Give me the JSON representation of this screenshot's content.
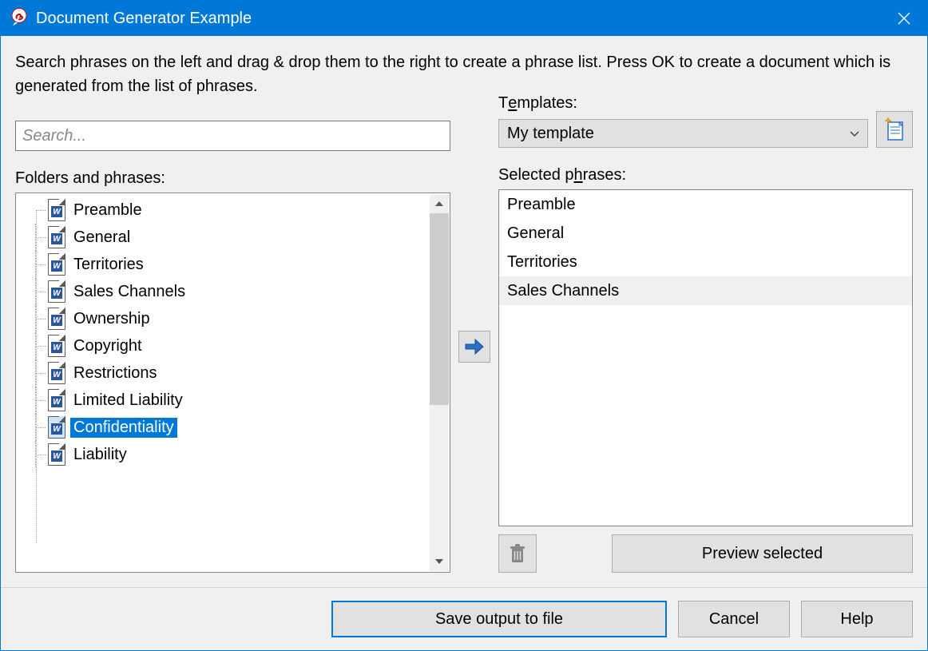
{
  "title": "Document Generator Example",
  "instructions": "Search phrases on the left and drag & drop them to the right to create a phrase list. Press OK to create a document which is generated from the list of phrases.",
  "search": {
    "placeholder": "Search..."
  },
  "labels": {
    "folders_and_phrases": "Folders and phrases:",
    "templates_prefix": "T",
    "templates_ul": "e",
    "templates_suffix": "mplates:",
    "selected_prefix": "Selected p",
    "selected_ul": "h",
    "selected_suffix": "rases:"
  },
  "templates": {
    "selected": "My template"
  },
  "folders": [
    {
      "label": "Preamble",
      "selected": false
    },
    {
      "label": "General",
      "selected": false
    },
    {
      "label": "Territories",
      "selected": false
    },
    {
      "label": "Sales Channels",
      "selected": false
    },
    {
      "label": "Ownership",
      "selected": false
    },
    {
      "label": "Copyright",
      "selected": false
    },
    {
      "label": "Restrictions",
      "selected": false
    },
    {
      "label": "Limited Liability",
      "selected": false
    },
    {
      "label": "Confidentiality",
      "selected": true
    },
    {
      "label": "Liability",
      "selected": false
    }
  ],
  "selected_phrases": [
    {
      "label": "Preamble",
      "highlight": false
    },
    {
      "label": "General",
      "highlight": false
    },
    {
      "label": "Territories",
      "highlight": false
    },
    {
      "label": "Sales Channels",
      "highlight": true
    }
  ],
  "buttons": {
    "preview": "Preview selected",
    "save": "Save output to file",
    "cancel": "Cancel",
    "help": "Help"
  }
}
